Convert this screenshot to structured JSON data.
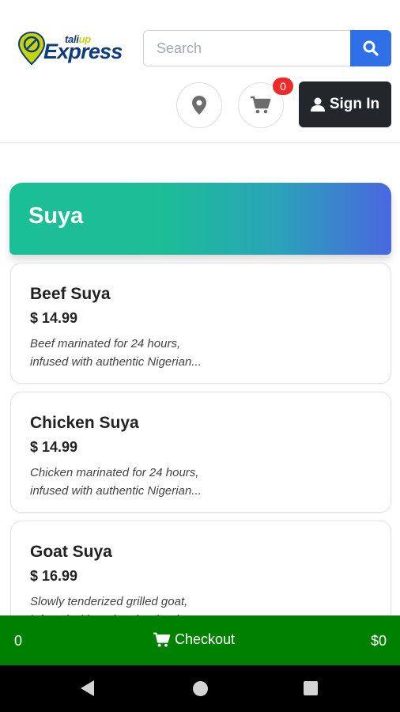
{
  "header": {
    "logo": {
      "small_text_a": "tali",
      "small_text_b": "up",
      "big_text": "Express"
    },
    "search": {
      "placeholder": "Search"
    },
    "cart_count": "0",
    "signin_label": "Sign In"
  },
  "category": {
    "title": "Suya"
  },
  "items": [
    {
      "name": "Beef Suya",
      "price": "$ 14.99",
      "desc_line1": "Beef marinated for 24 hours,",
      "desc_line2": "infused with authentic Nigerian..."
    },
    {
      "name": "Chicken Suya",
      "price": "$ 14.99",
      "desc_line1": "Chicken marinated for 24 hours,",
      "desc_line2": "infused with authentic Nigerian..."
    },
    {
      "name": "Goat Suya",
      "price": "$ 16.99",
      "desc_line1": "Slowly tenderized grilled goat,",
      "desc_line2": "infused with authentic Nigerian..."
    }
  ],
  "checkout": {
    "count": "0",
    "label": "Checkout",
    "total": "$0"
  },
  "colors": {
    "accent": "#2f6fe8",
    "checkout": "#008000",
    "badge": "#ee2b2b",
    "signin": "#23272b",
    "banner_start": "#1bbf95",
    "banner_end": "#4a67e0"
  },
  "icons": [
    "search-icon",
    "location-pin-icon",
    "cart-icon",
    "user-icon",
    "back-icon",
    "home-icon",
    "recents-icon"
  ]
}
